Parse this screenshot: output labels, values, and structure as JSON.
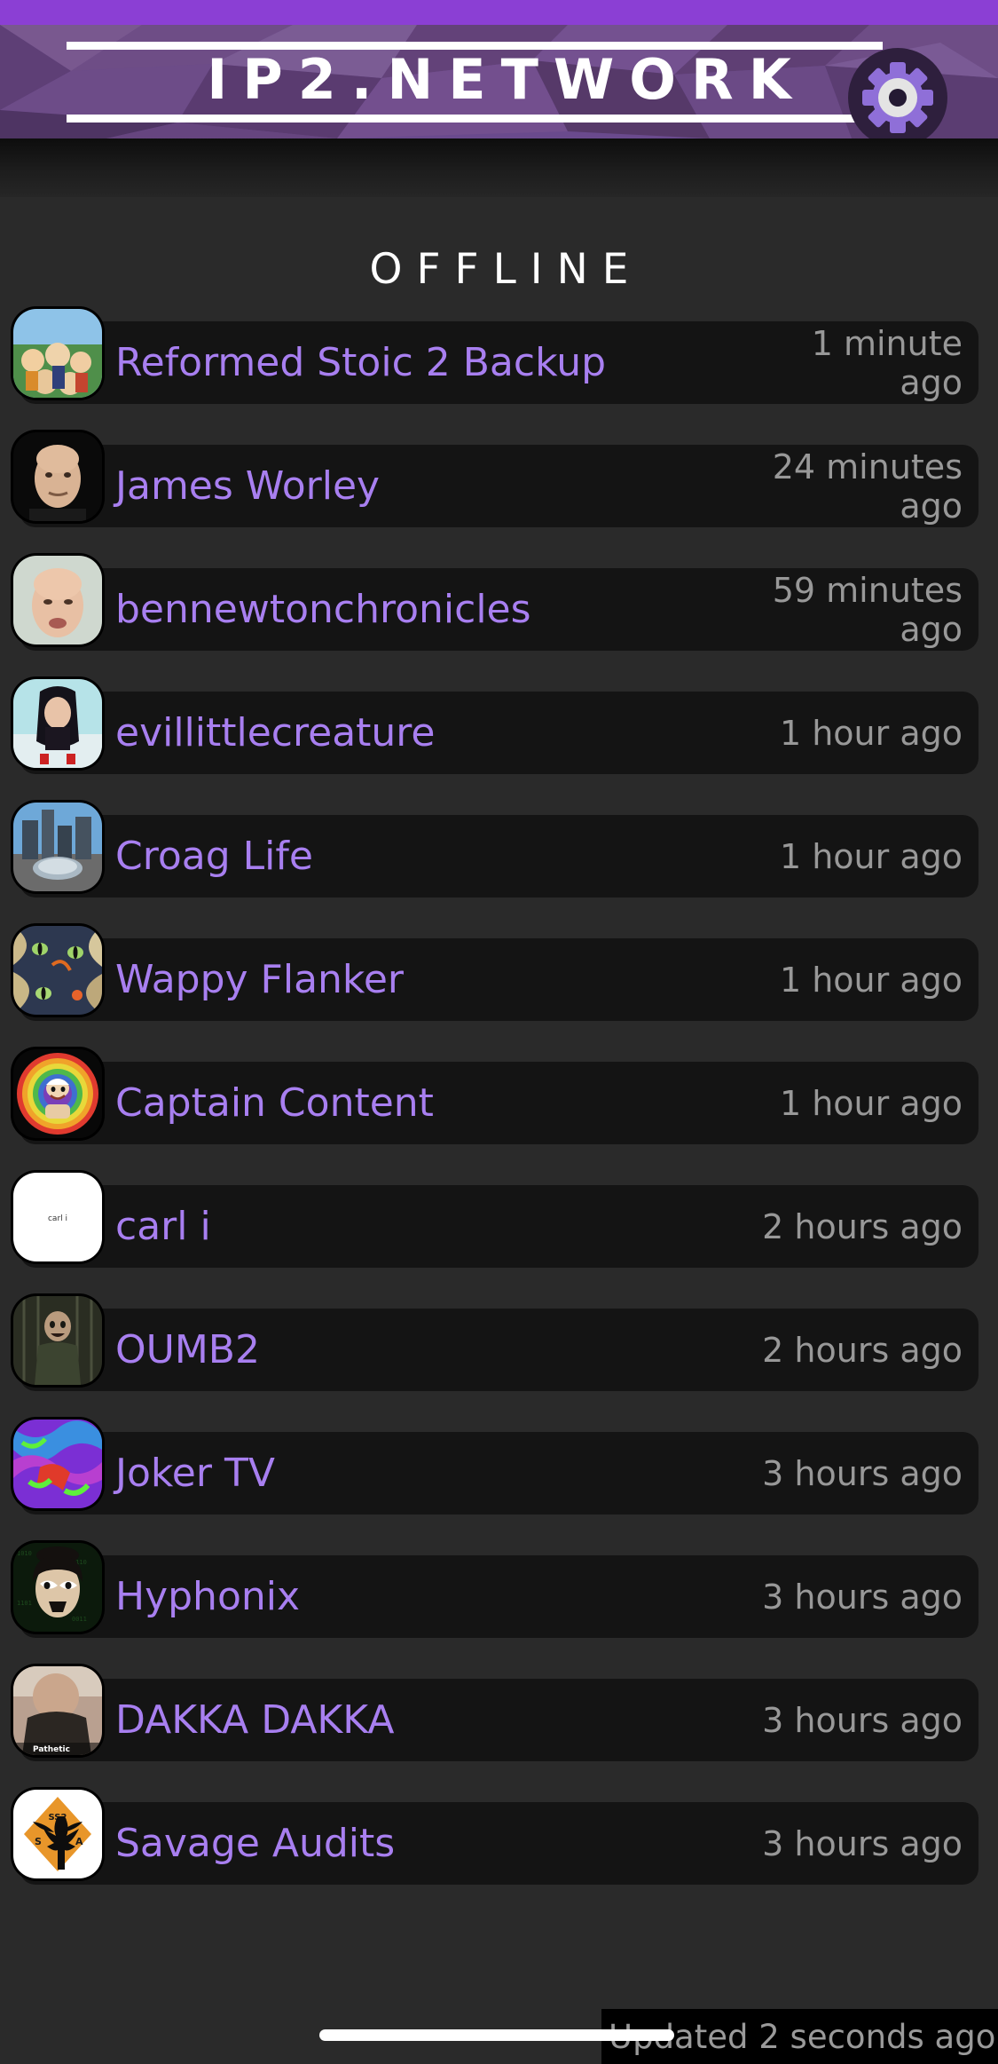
{
  "statusbar": {
    "color": "#8b3fd4"
  },
  "header": {
    "wordmark": "IP2.NETWORK",
    "settings_icon": "gear-icon",
    "accent": "#7b4fa8"
  },
  "section": {
    "title": "OFFLINE"
  },
  "colors": {
    "page_bg": "#2a2a2a",
    "row_bg": "#141414",
    "name": "#a87ff0",
    "timestamp": "#989898",
    "heading": "#ffffff"
  },
  "list": {
    "items": [
      {
        "name": "Reformed Stoic 2 Backup",
        "time": "1 minute ago",
        "avatar": "dragonball-group"
      },
      {
        "name": "James Worley",
        "time": "24 minutes ago",
        "avatar": "bald-man-portrait"
      },
      {
        "name": "bennewtonchronicles",
        "time": "59 minutes ago",
        "avatar": "man-face-light"
      },
      {
        "name": "evillittlecreature",
        "time": "1 hour ago",
        "avatar": "woman-dark-hair"
      },
      {
        "name": "Croag Life",
        "time": "1 hour ago",
        "avatar": "city-skyline"
      },
      {
        "name": "Wappy Flanker",
        "time": "1 hour ago",
        "avatar": "abstract-cat-eyes"
      },
      {
        "name": "Captain Content",
        "time": "1 hour ago",
        "avatar": "rainbow-captain-logo"
      },
      {
        "name": "carl i",
        "time": "2 hours ago",
        "avatar": "white-carl-i-text"
      },
      {
        "name": "OUMB2",
        "time": "2 hours ago",
        "avatar": "dark-soldier"
      },
      {
        "name": "Joker TV",
        "time": "3 hours ago",
        "avatar": "neon-psychedelic"
      },
      {
        "name": "Hyphonix",
        "time": "3 hours ago",
        "avatar": "cartoon-angry-face"
      },
      {
        "name": "DAKKA DAKKA",
        "time": "3 hours ago",
        "avatar": "man-pathetic-caption"
      },
      {
        "name": "Savage Audits",
        "time": "3 hours ago",
        "avatar": "orange-eagle-badge"
      }
    ]
  },
  "toast": {
    "text": "Updated 2 seconds ago..."
  }
}
